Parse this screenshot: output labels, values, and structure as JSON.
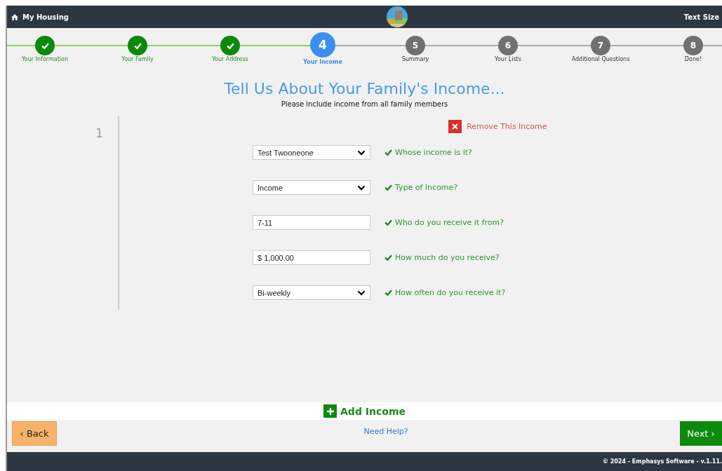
{
  "top_bar": {
    "title": "My Housing",
    "text_size": "Text Size"
  },
  "steps": [
    {
      "label": "Your Information",
      "done": true,
      "selected": false
    },
    {
      "label": "Your Family",
      "done": true,
      "selected": false
    },
    {
      "label": "Your Address",
      "done": true,
      "selected": false
    },
    {
      "number": "4",
      "label": "Your Income",
      "done": false,
      "selected": true
    },
    {
      "number": "5",
      "label": "Summary",
      "done": false,
      "selected": false
    },
    {
      "number": "6",
      "label": "Your Lists",
      "done": false,
      "selected": false
    },
    {
      "number": "7",
      "label": "Additional Questions",
      "done": false,
      "selected": false
    },
    {
      "number": "8",
      "label": "Done!",
      "done": false,
      "selected": false
    }
  ],
  "heading": "Tell Us About Your Family's Income...",
  "subheading": "Please include income from all family members",
  "income": {
    "index": "1",
    "remove": "Remove This Income",
    "fields": [
      {
        "kind": "select",
        "value": "Test Twooneone",
        "label": "Whose income is it?",
        "valid": true
      },
      {
        "kind": "select",
        "value": "Income",
        "label": "Type of Income?",
        "valid": true
      },
      {
        "kind": "text",
        "value": "7-11",
        "label": "Who do you receive it from?",
        "valid": true
      },
      {
        "kind": "text",
        "value": "$ 1,000.00",
        "label": "How much do you receive?",
        "valid": true
      },
      {
        "kind": "select",
        "value": "Bi-weekly",
        "label": "How often do you receive it?",
        "valid": true
      }
    ]
  },
  "add_button": "Add Income",
  "back_button": "‹ Back",
  "help_link": "Need Help?",
  "next_button": "Next ›",
  "footer": "© 2024 - Emphasys Software - v.1.11."
}
